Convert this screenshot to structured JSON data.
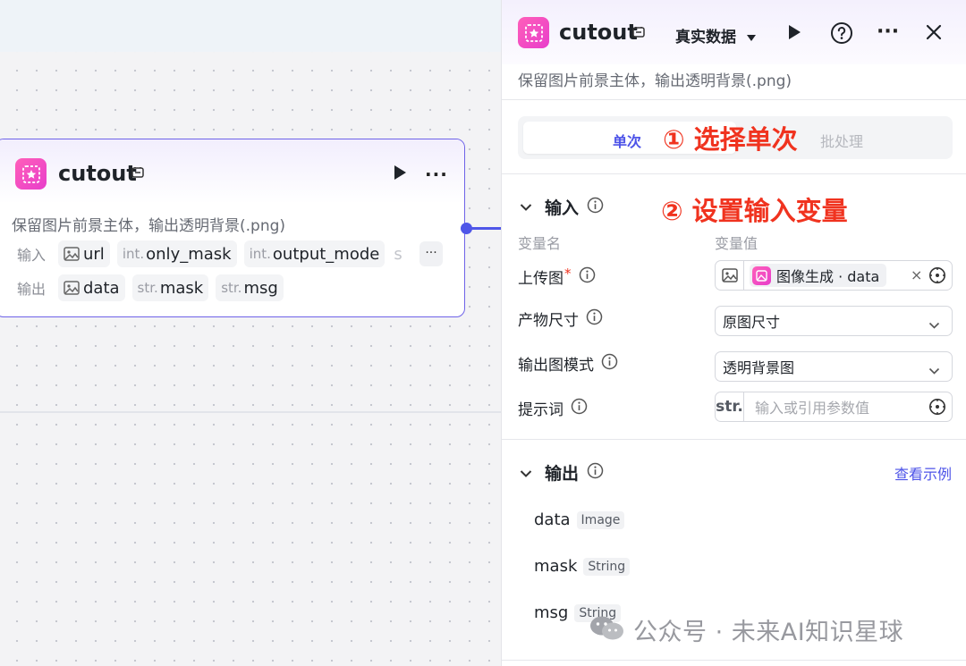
{
  "node": {
    "title": "cutout",
    "description": "保留图片前景主体，输出透明背景(.png)",
    "input_label": "输入",
    "output_label": "输出",
    "inputs": [
      {
        "type": "",
        "name": "url",
        "icon": "image-icon"
      },
      {
        "type": "int.",
        "name": "only_mask"
      },
      {
        "type": "int.",
        "name": "output_mode"
      },
      {
        "type": "",
        "name": "s"
      }
    ],
    "outputs": [
      {
        "type": "",
        "name": "data",
        "icon": "image-icon"
      },
      {
        "type": "str.",
        "name": "mask"
      },
      {
        "type": "str.",
        "name": "msg"
      }
    ],
    "more": "···"
  },
  "panel": {
    "title": "cutout",
    "mode_select": "真实数据",
    "more": "···",
    "description": "保留图片前景主体，输出透明背景(.png)",
    "tabs": {
      "single": "单次",
      "batch": "批处理"
    },
    "annotation_1": "① 选择单次",
    "annotation_2": "② 设置输入变量",
    "input_section": {
      "title": "输入",
      "col_name": "变量名",
      "col_value": "变量值",
      "fields": [
        {
          "label": "上传图",
          "required": "*",
          "ref_text": "图像生成 · data",
          "clear": "×"
        },
        {
          "label": "产物尺寸",
          "value": "原图尺寸"
        },
        {
          "label": "输出图模式",
          "value": "透明背景图"
        },
        {
          "label": "提示词",
          "prefix": "str.",
          "placeholder": "输入或引用参数值"
        }
      ]
    },
    "output_section": {
      "title": "输出",
      "view_example": "查看示例",
      "items": [
        {
          "name": "data",
          "type": "Image"
        },
        {
          "name": "mask",
          "type": "String"
        },
        {
          "name": "msg",
          "type": "String"
        }
      ]
    }
  },
  "watermark": "公众号 · 未来AI知识星球",
  "colors": {
    "accent": "#4d53e8",
    "annotation": "#f0331f",
    "node_border": "#6e63e8",
    "logo": "#e83ecb"
  }
}
